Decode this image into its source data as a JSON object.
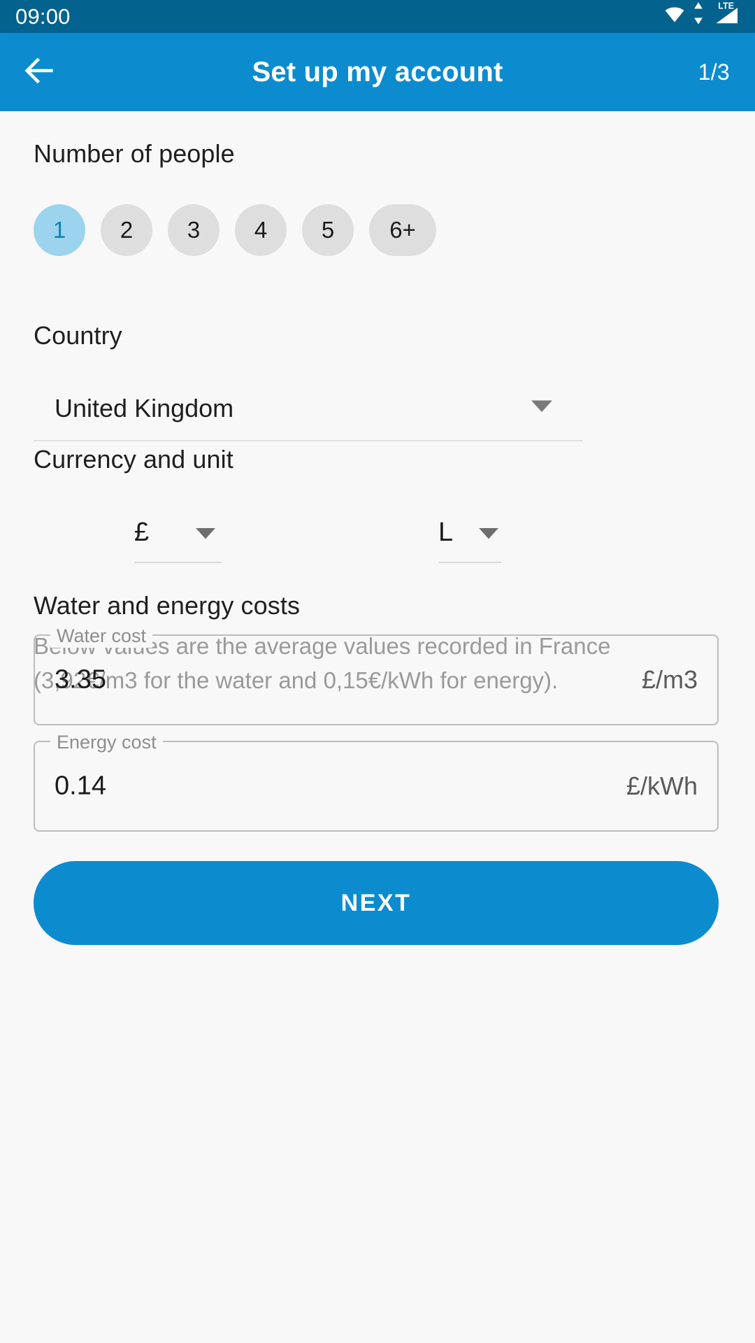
{
  "status_bar": {
    "time": "09:00",
    "icons": [
      "wifi-icon",
      "mobile-data-arrows-icon",
      "lte-signal-icon"
    ],
    "network_label": "LTE",
    "background_color": "#04628F"
  },
  "app_bar": {
    "back_icon": "arrow-left-icon",
    "title": "Set up my account",
    "step_counter": "1/3",
    "background_color": "#0C8CCE"
  },
  "people": {
    "section_label": "Number of people",
    "options": [
      {
        "label": "1",
        "selected": true
      },
      {
        "label": "2",
        "selected": false
      },
      {
        "label": "3",
        "selected": false
      },
      {
        "label": "4",
        "selected": false
      },
      {
        "label": "5",
        "selected": false
      },
      {
        "label": "6+",
        "selected": false
      }
    ],
    "selected_bg_color": "#9BD4EC",
    "selected_text_color": "#0F82B8",
    "unselected_bg_color": "#DEDEDE"
  },
  "country": {
    "section_label": "Country",
    "value": "United Kingdom",
    "dropdown_icon": "chevron-down-icon"
  },
  "currency_and_unit": {
    "section_label": "Currency and unit",
    "currency": {
      "value": "£",
      "dropdown_icon": "triangle-down-icon"
    },
    "unit": {
      "value": "L",
      "dropdown_icon": "triangle-down-icon"
    }
  },
  "costs": {
    "section_label": "Water and energy costs",
    "description": "Below values are the average values recorded in France (3,92€/m3 for the water and 0,15€/kWh for energy).",
    "water": {
      "label": "Water cost",
      "value": "3.35",
      "suffix": "£/m3"
    },
    "energy": {
      "label": "Energy cost",
      "value": "0.14",
      "suffix": "£/kWh"
    }
  },
  "actions": {
    "next_label": "NEXT",
    "next_color": "#0C8CCE"
  }
}
